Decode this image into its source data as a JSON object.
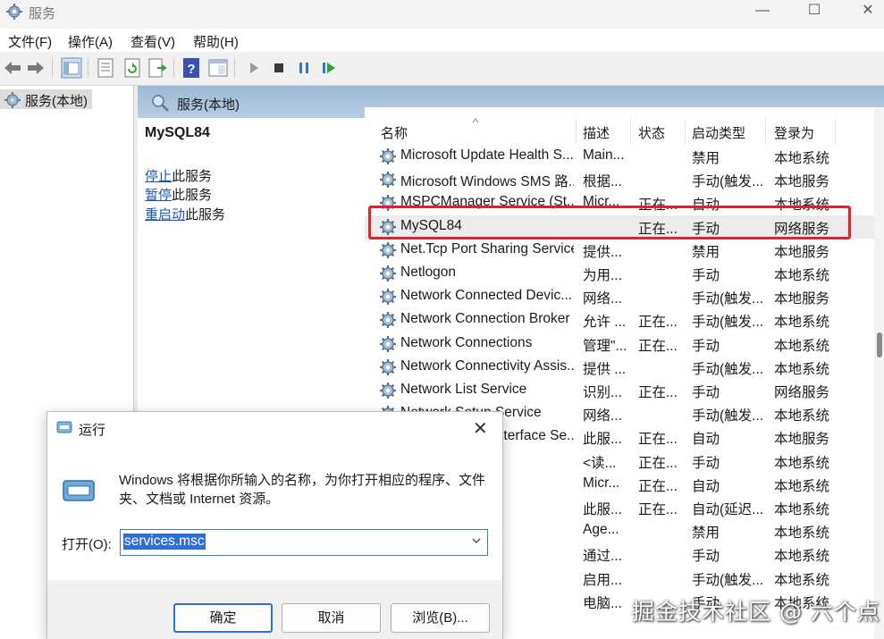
{
  "window": {
    "title": "服务",
    "minimize_glyph": "—",
    "maximize_glyph": "☐",
    "close_glyph": "✕"
  },
  "menu": [
    "文件(F)",
    "操作(A)",
    "查看(V)",
    "帮助(H)"
  ],
  "toolbar_icons": [
    "back-icon",
    "forward-icon",
    "console-tree-icon",
    "properties-icon",
    "refresh-icon",
    "export-list-icon",
    "help-icon",
    "show-hide-icon",
    "start-service-icon",
    "stop-service-icon",
    "pause-service-icon",
    "resume-service-icon"
  ],
  "tree": {
    "root_label": "服务(本地)"
  },
  "panel": {
    "title": "服务(本地)"
  },
  "detail": {
    "service_name": "MySQL84",
    "stop_link": "停止",
    "stop_suffix": "此服务",
    "pause_link": "暂停",
    "pause_suffix": "此服务",
    "restart_link": "重启动",
    "restart_suffix": "此服务"
  },
  "columns": {
    "name": "名称",
    "description": "描述",
    "status": "状态",
    "startup": "启动类型",
    "logon": "登录为"
  },
  "rows": [
    {
      "name": "Microsoft Update Health S...",
      "desc": "Main...",
      "status": "",
      "startup": "禁用",
      "logon": "本地系统"
    },
    {
      "name": "Microsoft Windows SMS 路...",
      "desc": "根据...",
      "status": "",
      "startup": "手动(触发...",
      "logon": "本地服务"
    },
    {
      "name": "MSPCManager Service (St...",
      "desc": "Micr...",
      "status": "正在...",
      "startup": "自动",
      "logon": "本地系统"
    },
    {
      "name": "MySQL84",
      "desc": "",
      "status": "正在...",
      "startup": "手动",
      "logon": "网络服务"
    },
    {
      "name": "Net.Tcp Port Sharing Service",
      "desc": "提供...",
      "status": "",
      "startup": "禁用",
      "logon": "本地服务"
    },
    {
      "name": "Netlogon",
      "desc": "为用...",
      "status": "",
      "startup": "手动",
      "logon": "本地系统"
    },
    {
      "name": "Network Connected Devic...",
      "desc": "网络...",
      "status": "",
      "startup": "手动(触发...",
      "logon": "本地服务"
    },
    {
      "name": "Network Connection Broker",
      "desc": "允许 ...",
      "status": "正在...",
      "startup": "手动(触发...",
      "logon": "本地系统"
    },
    {
      "name": "Network Connections",
      "desc": "管理\"...",
      "status": "正在...",
      "startup": "手动",
      "logon": "本地系统"
    },
    {
      "name": "Network Connectivity Assis...",
      "desc": "提供 ...",
      "status": "",
      "startup": "手动(触发...",
      "logon": "本地系统"
    },
    {
      "name": "Network List Service",
      "desc": "识别...",
      "status": "正在...",
      "startup": "手动",
      "logon": "网络服务"
    },
    {
      "name": "Network Setup Service",
      "desc": "网络...",
      "status": "",
      "startup": "手动(触发...",
      "logon": "本地系统"
    },
    {
      "name": "Network Store Interface Se...",
      "desc": "此服...",
      "status": "正在...",
      "startup": "自动",
      "logon": "本地服务"
    },
    {
      "name": "",
      "desc": "<读...",
      "status": "正在...",
      "startup": "手动",
      "logon": "本地系统"
    },
    {
      "name": "ce",
      "desc": "Micr...",
      "status": "正在...",
      "startup": "自动",
      "logon": "本地系统"
    },
    {
      "name": "97",
      "desc": "此服...",
      "status": "正在...",
      "startup": "自动(延迟...",
      "logon": "本地系统"
    },
    {
      "name": "ntication ...",
      "desc": "Age...",
      "status": "",
      "startup": "禁用",
      "logon": "本地系统"
    },
    {
      "name": "",
      "desc": "通过...",
      "status": "",
      "startup": "手动",
      "logon": "本地系统"
    },
    {
      "name": "c97",
      "desc": "启用...",
      "status": "",
      "startup": "手动(触发...",
      "logon": "本地系统"
    },
    {
      "name": "Service",
      "desc": "电脑...",
      "status": "",
      "startup": "手动",
      "logon": "本地系统"
    }
  ],
  "selected_row": 3,
  "run_dialog": {
    "title": "运行",
    "close_glyph": "✕",
    "description": "Windows 将根据你所输入的名称，为你打开相应的程序、文件夹、文档或 Internet 资源。",
    "open_label": "打开(O):",
    "input_value": "services.msc",
    "ok_label": "确定",
    "cancel_label": "取消",
    "browse_label": "浏览(B)..."
  },
  "watermark": "掘金技术社区 @ 六个点",
  "colors": {
    "highlight_border": "#d9252b",
    "link": "#1a55b0",
    "header_gradient": "#9fb9d4",
    "selection": "#2f6fd4"
  }
}
